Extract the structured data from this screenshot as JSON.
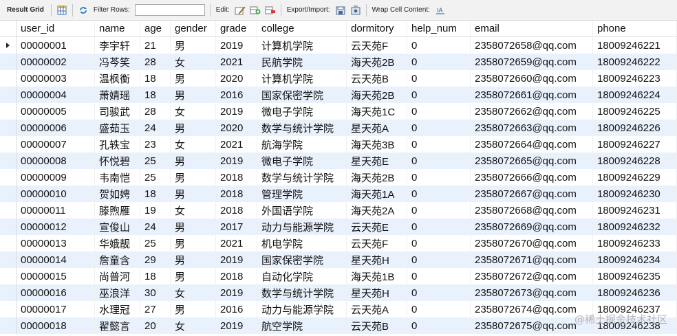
{
  "toolbar": {
    "result_grid": "Result Grid",
    "filter_rows": "Filter Rows:",
    "filter_value": "",
    "edit": "Edit:",
    "export_import": "Export/Import:",
    "wrap_cell": "Wrap Cell Content:"
  },
  "columns": [
    "user_id",
    "name",
    "age",
    "gender",
    "grade",
    "college",
    "dormitory",
    "help_num",
    "email",
    "phone"
  ],
  "rows": [
    [
      "00000001",
      "李宇轩",
      "21",
      "男",
      "2019",
      "计算机学院",
      "云天苑F",
      "0",
      "2358072658@qq.com",
      "18009246221"
    ],
    [
      "00000002",
      "冯芩笑",
      "28",
      "女",
      "2021",
      "民航学院",
      "海天苑2B",
      "0",
      "2358072659@qq.com",
      "18009246222"
    ],
    [
      "00000003",
      "温枫衡",
      "18",
      "男",
      "2020",
      "计算机学院",
      "云天苑B",
      "0",
      "2358072660@qq.com",
      "18009246223"
    ],
    [
      "00000004",
      "萧婧瑶",
      "18",
      "男",
      "2016",
      "国家保密学院",
      "海天苑2B",
      "0",
      "2358072661@qq.com",
      "18009246224"
    ],
    [
      "00000005",
      "司骏武",
      "28",
      "女",
      "2019",
      "微电子学院",
      "海天苑1C",
      "0",
      "2358072662@qq.com",
      "18009246225"
    ],
    [
      "00000006",
      "盛茹玉",
      "24",
      "男",
      "2020",
      "数学与统计学院",
      "星天苑A",
      "0",
      "2358072663@qq.com",
      "18009246226"
    ],
    [
      "00000007",
      "孔轶宝",
      "23",
      "女",
      "2021",
      "航海学院",
      "海天苑3B",
      "0",
      "2358072664@qq.com",
      "18009246227"
    ],
    [
      "00000008",
      "怀悦碧",
      "25",
      "男",
      "2019",
      "微电子学院",
      "星天苑E",
      "0",
      "2358072665@qq.com",
      "18009246228"
    ],
    [
      "00000009",
      "韦南恺",
      "25",
      "男",
      "2018",
      "数学与统计学院",
      "海天苑2B",
      "0",
      "2358072666@qq.com",
      "18009246229"
    ],
    [
      "00000010",
      "贺如娉",
      "18",
      "男",
      "2018",
      "管理学院",
      "海天苑1A",
      "0",
      "2358072667@qq.com",
      "18009246230"
    ],
    [
      "00000011",
      "滕煦雁",
      "19",
      "女",
      "2018",
      "外国语学院",
      "海天苑2A",
      "0",
      "2358072668@qq.com",
      "18009246231"
    ],
    [
      "00000012",
      "宣俊山",
      "24",
      "男",
      "2017",
      "动力与能源学院",
      "云天苑E",
      "0",
      "2358072669@qq.com",
      "18009246232"
    ],
    [
      "00000013",
      "华娥靓",
      "25",
      "男",
      "2021",
      "机电学院",
      "云天苑F",
      "0",
      "2358072670@qq.com",
      "18009246233"
    ],
    [
      "00000014",
      "詹童含",
      "29",
      "男",
      "2019",
      "国家保密学院",
      "星天苑H",
      "0",
      "2358072671@qq.com",
      "18009246234"
    ],
    [
      "00000015",
      "尚普河",
      "18",
      "男",
      "2018",
      "自动化学院",
      "海天苑1B",
      "0",
      "2358072672@qq.com",
      "18009246235"
    ],
    [
      "00000016",
      "巫浪洋",
      "30",
      "女",
      "2019",
      "数学与统计学院",
      "星天苑H",
      "0",
      "2358072673@qq.com",
      "18009246236"
    ],
    [
      "00000017",
      "水理冠",
      "27",
      "男",
      "2016",
      "动力与能源学院",
      "云天苑A",
      "0",
      "2358072674@qq.com",
      "18009246237"
    ],
    [
      "00000018",
      "翟懿言",
      "20",
      "女",
      "2019",
      "航空学院",
      "云天苑B",
      "0",
      "2358072675@qq.com",
      "18009246238"
    ]
  ],
  "watermark": "@稀土掘金技术社区"
}
